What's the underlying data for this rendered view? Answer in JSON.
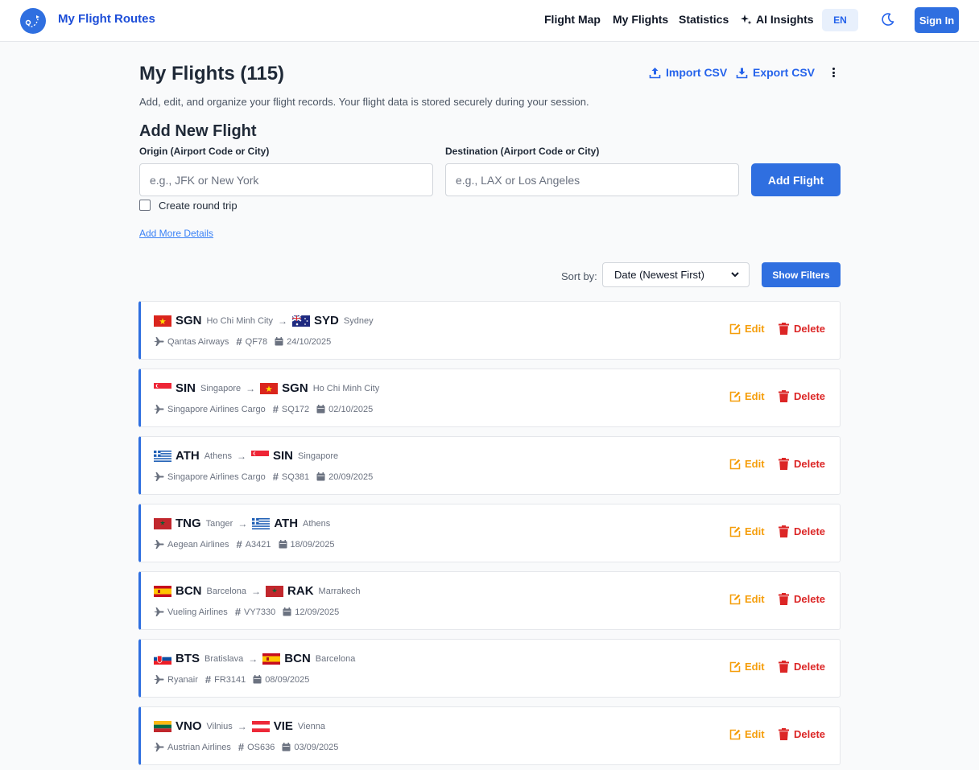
{
  "header": {
    "brand": "My Flight Routes",
    "nav": {
      "flight_map": "Flight Map",
      "my_flights": "My Flights",
      "statistics": "Statistics",
      "ai_insights": "AI Insights"
    },
    "language": "EN",
    "sign_in": "Sign In"
  },
  "page": {
    "title": "My Flights (115)",
    "import_csv": "Import CSV",
    "export_csv": "Export CSV",
    "subtitle": "Add, edit, and organize your flight records. Your flight data is stored securely during your session."
  },
  "add_flight": {
    "title": "Add New Flight",
    "origin_label": "Origin (Airport Code or City)",
    "origin_placeholder": "e.g., JFK or New York",
    "destination_label": "Destination (Airport Code or City)",
    "destination_placeholder": "e.g., LAX or Los Angeles",
    "submit": "Add Flight",
    "round_trip_label": "Create round trip",
    "more_details": "Add More Details"
  },
  "list_controls": {
    "sort_label": "Sort by:",
    "sort_value": "Date (Newest First)",
    "show_filters": "Show Filters"
  },
  "actions": {
    "edit": "Edit",
    "delete": "Delete"
  },
  "flights": [
    {
      "from_code": "SGN",
      "from_city": "Ho Chi Minh City",
      "from_flag": "VN",
      "to_code": "SYD",
      "to_city": "Sydney",
      "to_flag": "AU",
      "airline": "Qantas Airways",
      "flight_no": "QF78",
      "date": "24/10/2025"
    },
    {
      "from_code": "SIN",
      "from_city": "Singapore",
      "from_flag": "SG",
      "to_code": "SGN",
      "to_city": "Ho Chi Minh City",
      "to_flag": "VN",
      "airline": "Singapore Airlines Cargo",
      "flight_no": "SQ172",
      "date": "02/10/2025"
    },
    {
      "from_code": "ATH",
      "from_city": "Athens",
      "from_flag": "GR",
      "to_code": "SIN",
      "to_city": "Singapore",
      "to_flag": "SG",
      "airline": "Singapore Airlines Cargo",
      "flight_no": "SQ381",
      "date": "20/09/2025"
    },
    {
      "from_code": "TNG",
      "from_city": "Tanger",
      "from_flag": "MA",
      "to_code": "ATH",
      "to_city": "Athens",
      "to_flag": "GR",
      "airline": "Aegean Airlines",
      "flight_no": "A3421",
      "date": "18/09/2025"
    },
    {
      "from_code": "BCN",
      "from_city": "Barcelona",
      "from_flag": "ES",
      "to_code": "RAK",
      "to_city": "Marrakech",
      "to_flag": "MA",
      "airline": "Vueling Airlines",
      "flight_no": "VY7330",
      "date": "12/09/2025"
    },
    {
      "from_code": "BTS",
      "from_city": "Bratislava",
      "from_flag": "SK",
      "to_code": "BCN",
      "to_city": "Barcelona",
      "to_flag": "ES",
      "airline": "Ryanair",
      "flight_no": "FR3141",
      "date": "08/09/2025"
    },
    {
      "from_code": "VNO",
      "from_city": "Vilnius",
      "from_flag": "LT",
      "to_code": "VIE",
      "to_city": "Vienna",
      "to_flag": "AT",
      "airline": "Austrian Airlines",
      "flight_no": "OS636",
      "date": "03/09/2025"
    }
  ],
  "colors": {
    "primary": "#2f6fe0",
    "edit": "#f59e0b",
    "delete": "#dc2626"
  }
}
